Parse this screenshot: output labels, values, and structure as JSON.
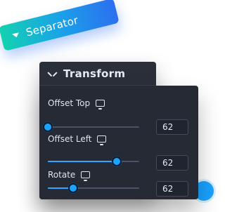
{
  "separator": {
    "label": "Separator"
  },
  "panel": {
    "title": "Transform",
    "rows": [
      {
        "label": "Offset Top",
        "value": "62",
        "slider_fraction": 0.0
      },
      {
        "label": "Offset Left",
        "value": "62",
        "slider_fraction": 0.75
      },
      {
        "label": "Rotate",
        "value": "62",
        "slider_fraction": 0.28
      }
    ]
  },
  "colors": {
    "accent": "#1aa3ff",
    "panel_bg": "#252a34",
    "pill_gradient_start": "#13d1b0",
    "pill_gradient_end": "#2c6ff0"
  },
  "icons": {
    "separator_caret": "caret-down-icon",
    "transform_chevron": "chevron-down-icon",
    "device": "monitor-icon"
  }
}
